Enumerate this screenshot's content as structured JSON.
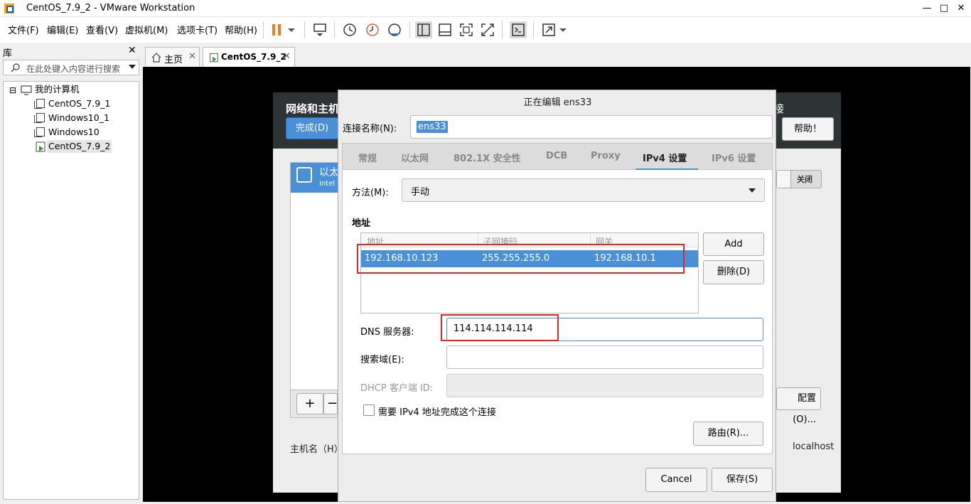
{
  "window": {
    "title": "CentOS_7.9_2 - VMware Workstation",
    "minimize": "—",
    "maximize": "□",
    "close": "✕"
  },
  "menu": [
    "文件(F)",
    "编辑(E)",
    "查看(V)",
    "虚拟机(M)",
    "选项卡(T)",
    "帮助(H)"
  ],
  "library": {
    "title": "库",
    "close": "✕",
    "search_placeholder": "在此处键入内容进行搜索",
    "root": "我的计算机",
    "items": [
      "CentOS_7.9_1",
      "Windows10_1",
      "Windows10",
      "CentOS_7.9_2"
    ],
    "expander": "⊟"
  },
  "tabs": [
    {
      "label": "主页",
      "close": "✕"
    },
    {
      "label": "CentOS_7.9_2",
      "close": "✕"
    }
  ],
  "background_window": {
    "title": "网络和主机",
    "title_right": "接",
    "done": "完成(D)",
    "help": "帮助！",
    "ethernet_name": "以太",
    "ethernet_sub": "Intel",
    "toggle": "关闭",
    "configure": "配置(O)...",
    "hostname_label": "主机名（H）",
    "hostname_value": "localhost",
    "add": "+",
    "remove": "−"
  },
  "dialog": {
    "title": "正在编辑 ens33",
    "connection_name_label": "连接名称(N):",
    "connection_name_value": "ens33",
    "tabs": [
      "常规",
      "以太网",
      "802.1X 安全性",
      "DCB",
      "Proxy",
      "IPv4 设置",
      "IPv6 设置"
    ],
    "active_tab": "IPv4 设置",
    "method_label": "方法(M):",
    "method_value": "手动",
    "address_section": "地址",
    "address_columns": [
      "地址",
      "子网掩码",
      "网关"
    ],
    "address_rows": [
      [
        "192.168.10.123",
        "255.255.255.0",
        "192.168.10.1"
      ]
    ],
    "add": "Add",
    "delete": "删除(D)",
    "dns_label": "DNS 服务器:",
    "dns_value": "114.114.114.114",
    "search_label": "搜索域(E):",
    "search_value": "",
    "dhcp_label": "DHCP 客户端 ID:",
    "dhcp_value": "",
    "require_ipv4_label": "需要 IPv4 地址完成这个连接",
    "routes": "路由(R)...",
    "cancel": "Cancel",
    "save": "保存(S)"
  },
  "colors": {
    "accent": "#4a90d9",
    "highlight_box": "#e0282a"
  }
}
